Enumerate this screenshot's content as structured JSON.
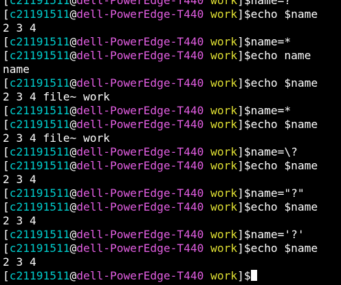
{
  "prompt": {
    "open": "[",
    "user": "c21191511",
    "at": "@",
    "host": "dell-PowerEdge-T440",
    "space": " ",
    "cwd": "work",
    "close": "]$"
  },
  "lines": [
    {
      "type": "prompt",
      "cmd": "name=?"
    },
    {
      "type": "prompt",
      "cmd": "echo $name"
    },
    {
      "type": "output",
      "text": "2 3 4"
    },
    {
      "type": "prompt",
      "cmd": "name=*"
    },
    {
      "type": "prompt",
      "cmd": "echo name"
    },
    {
      "type": "output",
      "text": "name"
    },
    {
      "type": "prompt",
      "cmd": "echo $name"
    },
    {
      "type": "output",
      "text": "2 3 4 file~ work"
    },
    {
      "type": "prompt",
      "cmd": "name=*"
    },
    {
      "type": "prompt",
      "cmd": "echo $name"
    },
    {
      "type": "output",
      "text": "2 3 4 file~ work"
    },
    {
      "type": "prompt",
      "cmd": "name=\\?"
    },
    {
      "type": "prompt",
      "cmd": "echo $name"
    },
    {
      "type": "output",
      "text": "2 3 4"
    },
    {
      "type": "prompt",
      "cmd": "name=\"?\""
    },
    {
      "type": "prompt",
      "cmd": "echo $name"
    },
    {
      "type": "output",
      "text": "2 3 4"
    },
    {
      "type": "prompt",
      "cmd": "name='?'"
    },
    {
      "type": "prompt",
      "cmd": "echo $name"
    },
    {
      "type": "output",
      "text": "2 3 4"
    },
    {
      "type": "prompt",
      "cmd": "",
      "cursor": true
    }
  ]
}
